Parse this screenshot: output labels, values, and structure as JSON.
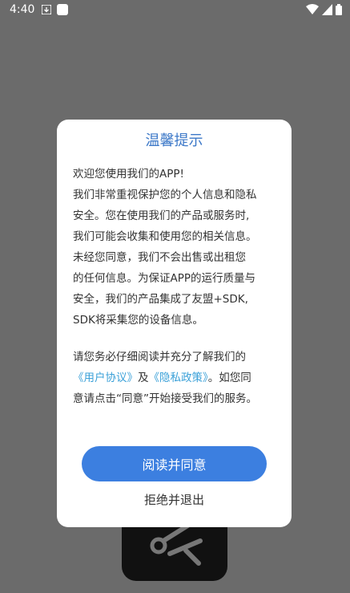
{
  "status_bar": {
    "time": "4:40",
    "icons": [
      "download-icon",
      "app-notification-icon",
      "wifi-icon",
      "signal-icon",
      "battery-icon"
    ]
  },
  "dialog": {
    "title": "温馨提示",
    "body_lines": [
      "欢迎您使用我们的APP!",
      "我们非常重视保护您的个人信息和隐私",
      "安全。您在使用我们的产品或服务时,",
      "我们可能会收集和使用您的相关信息。",
      "未经您同意，我们不会出售或出租您",
      "的任何信息。为保证APP的运行质量与",
      "安全，我们的产品集成了友盟+SDK,",
      "SDK将采集您的设备信息。"
    ],
    "notice_line1": "请您务必仔细阅读并充分了解我们的",
    "user_agreement_link": "《用户协议》",
    "and_text": "及",
    "privacy_policy_link": "《隐私政策》",
    "notice_tail": "。如您同",
    "notice_line3": "意请点击“同意”开始接受我们的服务。",
    "agree_label": "阅读并同意",
    "exit_label": "拒绝并退出"
  },
  "colors": {
    "accent": "#3c7fe0",
    "title": "#3c78c8",
    "link": "#3aa0d8",
    "overlay": "#6b6b6b"
  }
}
